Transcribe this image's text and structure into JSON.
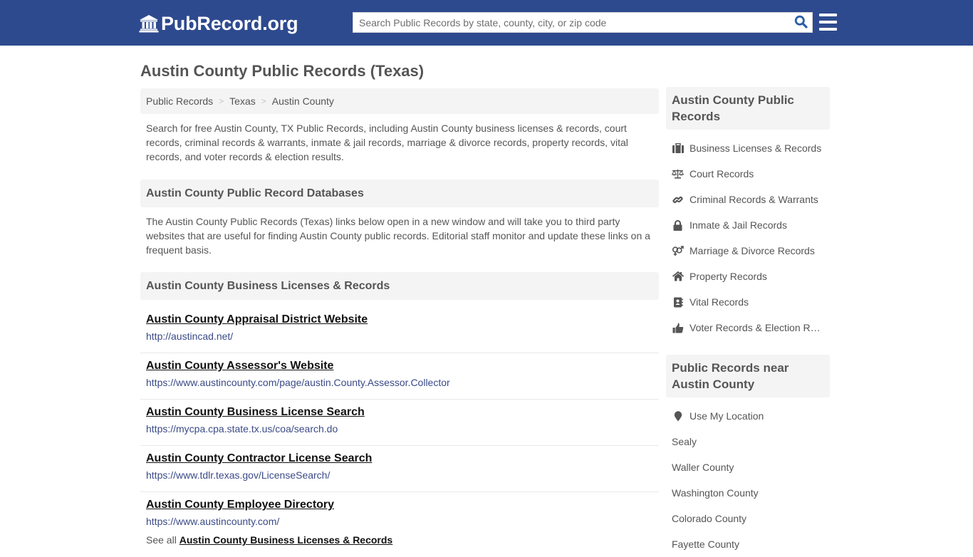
{
  "header": {
    "brand": "PubRecord.org",
    "brand_icon": "bank-building-icon",
    "search_placeholder": "Search Public Records by state, county, city, or zip code",
    "search_value": "",
    "search_icon": "search-icon",
    "menu_icon": "hamburger-menu-icon",
    "brand_color": "#2e4a8f"
  },
  "page": {
    "title": "Austin County Public Records (Texas)"
  },
  "breadcrumb": {
    "items": [
      "Public Records",
      "Texas",
      "Austin County"
    ],
    "separator": ">"
  },
  "intro": "Search for free Austin County, TX Public Records, including Austin County business licenses & records, court records, criminal records & warrants, inmate & jail records, marriage & divorce records, property records, vital records, and voter records & election results.",
  "databases": {
    "heading": "Austin County Public Record Databases",
    "description": "The Austin County Public Records (Texas) links below open in a new window and will take you to third party websites that are useful for finding Austin County public records. Editorial staff monitor and update these links on a frequent basis."
  },
  "business_section": {
    "heading": "Austin County Business Licenses & Records",
    "links": [
      {
        "title": "Austin County Appraisal District Website",
        "url": "http://austincad.net/"
      },
      {
        "title": "Austin County Assessor's Website",
        "url": "https://www.austincounty.com/page/austin.County.Assessor.Collector"
      },
      {
        "title": "Austin County Business License Search",
        "url": "https://mycpa.cpa.state.tx.us/coa/search.do"
      },
      {
        "title": "Austin County Contractor License Search",
        "url": "https://www.tdlr.texas.gov/LicenseSearch/"
      },
      {
        "title": "Austin County Employee Directory",
        "url": "https://www.austincounty.com/"
      }
    ],
    "see_all_prefix": "See all",
    "see_all_link": "Austin County Business Licenses & Records"
  },
  "sidebar": {
    "heading": "Austin County Public Records",
    "items": [
      {
        "label": "Business Licenses & Records",
        "icon": "briefcase-icon"
      },
      {
        "label": "Court Records",
        "icon": "balance-scale-icon"
      },
      {
        "label": "Criminal Records & Warrants",
        "icon": "link-icon"
      },
      {
        "label": "Inmate & Jail Records",
        "icon": "lock-icon"
      },
      {
        "label": "Marriage & Divorce Records",
        "icon": "venus-mars-icon"
      },
      {
        "label": "Property Records",
        "icon": "home-icon"
      },
      {
        "label": "Vital Records",
        "icon": "address-book-icon"
      },
      {
        "label": "Voter Records & Election Results",
        "icon": "thumbs-up-icon"
      }
    ],
    "near_heading": "Public Records near Austin County",
    "use_location": {
      "label": "Use My Location",
      "icon": "map-marker-icon"
    },
    "near_items": [
      "Sealy",
      "Waller County",
      "Washington County",
      "Colorado County",
      "Fayette County"
    ]
  }
}
